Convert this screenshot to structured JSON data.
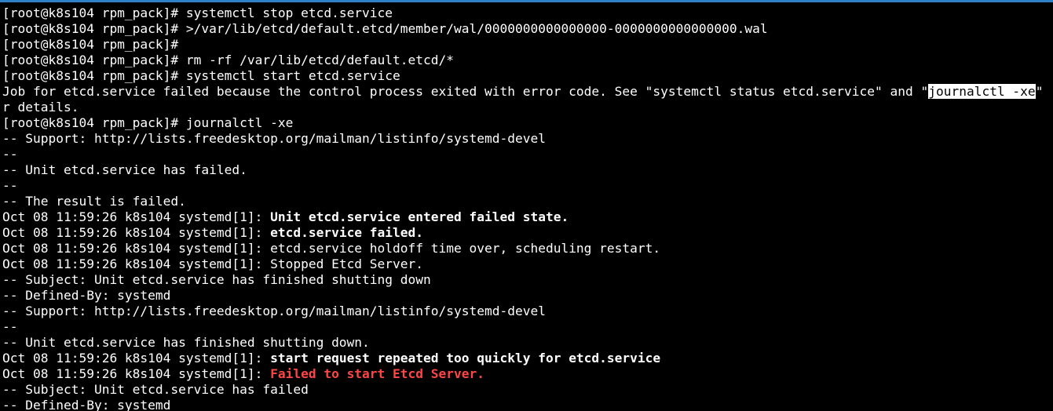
{
  "window": {
    "accent": "#2f7fc8",
    "background": "#000000",
    "foreground": "#ffffff",
    "error_color": "#ff4545"
  },
  "terminal": {
    "lines": [
      {
        "type": "prompt",
        "prompt": "[root@k8s104 rpm_pack]# ",
        "command": "systemctl stop etcd.service"
      },
      {
        "type": "prompt",
        "prompt": "[root@k8s104 rpm_pack]# ",
        "command": ">/var/lib/etcd/default.etcd/member/wal/0000000000000000-0000000000000000.wal"
      },
      {
        "type": "prompt",
        "prompt": "[root@k8s104 rpm_pack]# ",
        "command": ""
      },
      {
        "type": "prompt",
        "prompt": "[root@k8s104 rpm_pack]# ",
        "command": "rm -rf /var/lib/etcd/default.etcd/*"
      },
      {
        "type": "prompt",
        "prompt": "[root@k8s104 rpm_pack]# ",
        "command": "systemctl start etcd.service"
      },
      {
        "type": "selection",
        "before": "Job for etcd.service failed because the control process exited with error code. See \"systemctl status etcd.service\" and \"",
        "selected": "journalctl -xe",
        "after": "\" fo"
      },
      {
        "type": "plain",
        "text": "r details."
      },
      {
        "type": "prompt",
        "prompt": "[root@k8s104 rpm_pack]# ",
        "command": "journalctl -xe"
      },
      {
        "type": "plain",
        "text": "-- Support: http://lists.freedesktop.org/mailman/listinfo/systemd-devel"
      },
      {
        "type": "plain",
        "text": "--"
      },
      {
        "type": "plain",
        "text": "-- Unit etcd.service has failed."
      },
      {
        "type": "plain",
        "text": "--"
      },
      {
        "type": "plain",
        "text": "-- The result is failed."
      },
      {
        "type": "log",
        "prefix": "Oct 08 11:59:26 k8s104 systemd[1]: ",
        "message": "Unit etcd.service entered failed state.",
        "style": "bold"
      },
      {
        "type": "log",
        "prefix": "Oct 08 11:59:26 k8s104 systemd[1]: ",
        "message": "etcd.service failed.",
        "style": "bold"
      },
      {
        "type": "log",
        "prefix": "Oct 08 11:59:26 k8s104 systemd[1]: ",
        "message": "etcd.service holdoff time over, scheduling restart.",
        "style": "normal"
      },
      {
        "type": "log",
        "prefix": "Oct 08 11:59:26 k8s104 systemd[1]: ",
        "message": "Stopped Etcd Server.",
        "style": "normal"
      },
      {
        "type": "plain",
        "text": "-- Subject: Unit etcd.service has finished shutting down"
      },
      {
        "type": "plain",
        "text": "-- Defined-By: systemd"
      },
      {
        "type": "plain",
        "text": "-- Support: http://lists.freedesktop.org/mailman/listinfo/systemd-devel"
      },
      {
        "type": "plain",
        "text": "--"
      },
      {
        "type": "plain",
        "text": "-- Unit etcd.service has finished shutting down."
      },
      {
        "type": "log",
        "prefix": "Oct 08 11:59:26 k8s104 systemd[1]: ",
        "message": "start request repeated too quickly for etcd.service",
        "style": "bold"
      },
      {
        "type": "log",
        "prefix": "Oct 08 11:59:26 k8s104 systemd[1]: ",
        "message": "Failed to start Etcd Server.",
        "style": "error"
      },
      {
        "type": "plain",
        "text": "-- Subject: Unit etcd.service has failed"
      },
      {
        "type": "plain",
        "text": "-- Defined-By: systemd"
      }
    ]
  }
}
